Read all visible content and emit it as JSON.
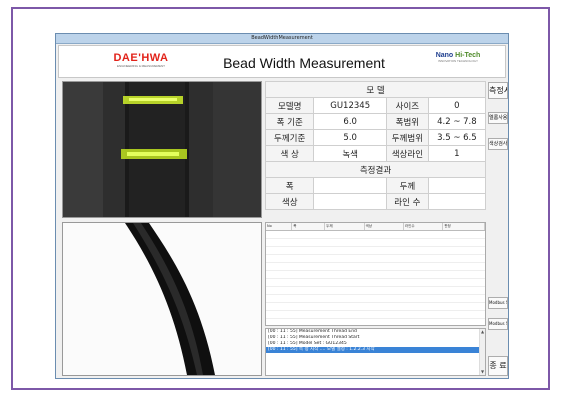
{
  "window": {
    "title": "BeadWidthMeasurement"
  },
  "header": {
    "left_logo": "DAE'HWA",
    "left_logo_sub": "ENGINEERING & MEASUREMENT",
    "app_title": "Bead Width Measurement",
    "right_logo_a": "Nano",
    "right_logo_b": "Hi-Tech",
    "right_logo_sub": "INNOVATION TECHNOLOGY"
  },
  "model_section": {
    "title": "모 델",
    "model_label": "모델명",
    "model_value": "GU12345",
    "size_label": "사이즈",
    "size_value": "0",
    "width_std_label": "폭 기준",
    "width_std_value": "6.0",
    "width_range_label": "폭범위",
    "width_range_value": "4.2 ~ 7.8",
    "thick_std_label": "두께기준",
    "thick_std_value": "5.0",
    "thick_range_label": "두께범위",
    "thick_range_value": "3.5 ~ 6.5",
    "color_label": "색 상",
    "color_value": "녹색",
    "color_line_label": "색상라인",
    "color_line_value": "1"
  },
  "result_section": {
    "title": "측정결과",
    "width_label": "폭",
    "width_value": "",
    "thickness_label": "두께",
    "thickness_value": "",
    "color_label": "색상",
    "color_value": "",
    "line_count_label": "라인 수",
    "line_count_value": ""
  },
  "grid": {
    "columns": [
      "No",
      "폭",
      "두께",
      "색상",
      "라인수",
      "판정"
    ]
  },
  "log": {
    "lines": [
      "[00 : 11 : 55] Measurement Thread End",
      "[00 : 11 : 55] Measurement Thread Start",
      "[00 : 11 : 55] Model Set : GU12345",
      "[00 : 11 : 55] 측 정 시작 .... 모델 설정 : 1.2.2.3 시작"
    ],
    "scroll_up": "▲",
    "scroll_down": "▼"
  },
  "buttons": {
    "start": "측정시작",
    "btn2": "엘롬사용 중",
    "btn3": "색상검사 중",
    "modbus_start": "Modbus Start",
    "modbus_set": "Modbus Set",
    "end": "종 료"
  },
  "colors": {
    "frame": "#7d58a8",
    "titlebar": "#bcd3ea",
    "logo_red": "#e2231a",
    "selection": "#3a83d6",
    "bead_green": "#c8e62a"
  }
}
